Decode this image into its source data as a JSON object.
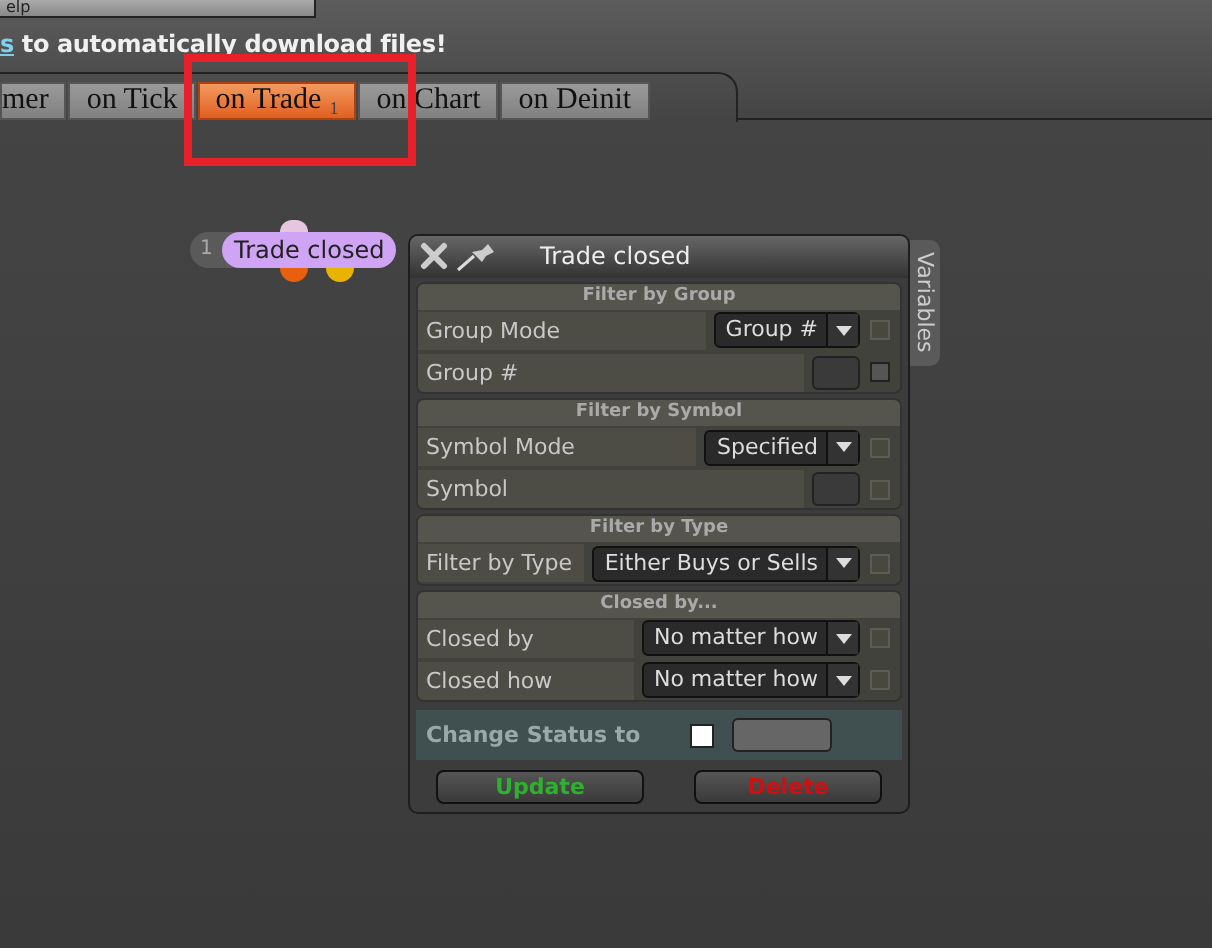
{
  "help_button": {
    "label": "elp"
  },
  "notice": {
    "link": "s",
    "text": " to automatically download files!"
  },
  "tabs": [
    {
      "label": "mer",
      "selected": false
    },
    {
      "label": "on Tick",
      "selected": false
    },
    {
      "label": "on Trade",
      "selected": true,
      "badge": "1"
    },
    {
      "label": "on Chart",
      "selected": false
    },
    {
      "label": "on Deinit",
      "selected": false
    }
  ],
  "node": {
    "number": "1",
    "label": "Trade closed",
    "ports": [
      {
        "color": "#e6c6de"
      },
      {
        "color": "#e8600e"
      },
      {
        "color": "#e8b400"
      }
    ]
  },
  "dialog": {
    "title": "Trade closed",
    "side_tab": "Variables",
    "sections": [
      {
        "title": "Filter by Group",
        "rows": [
          {
            "label": "Group Mode",
            "kind": "dropdown",
            "value": "Group #",
            "toggle_enabled": false
          },
          {
            "label": "Group #",
            "kind": "field",
            "toggle_enabled": true
          }
        ]
      },
      {
        "title": "Filter by Symbol",
        "rows": [
          {
            "label": "Symbol Mode",
            "kind": "dropdown",
            "value": "Specified",
            "toggle_enabled": false
          },
          {
            "label": "Symbol",
            "kind": "field",
            "toggle_enabled": false
          }
        ]
      },
      {
        "title": "Filter by Type",
        "rows": [
          {
            "label": "Filter by Type",
            "kind": "dropdown",
            "value": "Either Buys or Sells",
            "toggle_enabled": false
          }
        ]
      },
      {
        "title": "Closed by...",
        "rows": [
          {
            "label": "Closed by",
            "kind": "dropdown",
            "value": "No matter how",
            "toggle_enabled": false
          },
          {
            "label": "Closed how",
            "kind": "dropdown",
            "value": "No matter how",
            "toggle_enabled": false
          }
        ]
      }
    ],
    "status": {
      "label": "Change Status to",
      "checked": false
    },
    "buttons": [
      {
        "label": "Update",
        "kind": "confirm"
      },
      {
        "label": "Delete",
        "kind": "danger"
      }
    ]
  }
}
